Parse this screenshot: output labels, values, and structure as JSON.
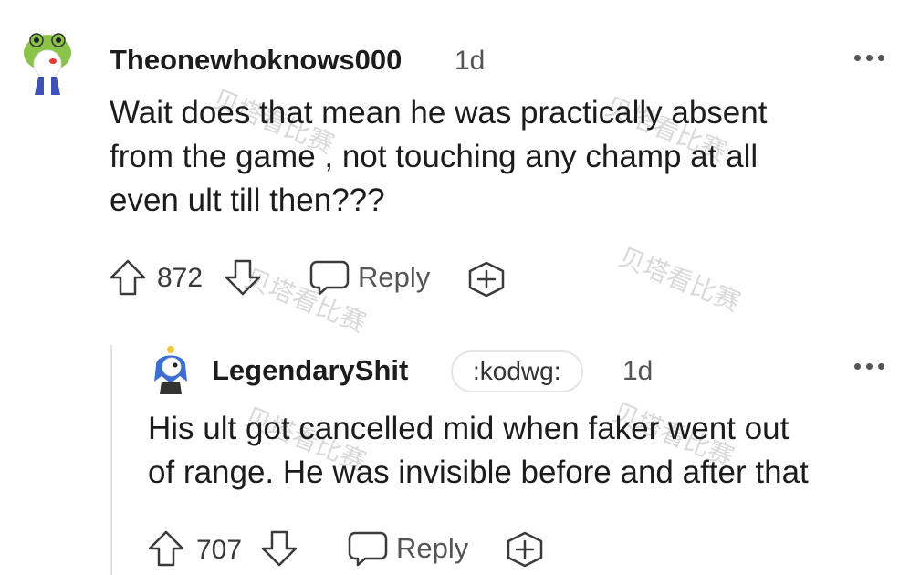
{
  "comment": {
    "username": "Theonewhoknows000",
    "time": "1d",
    "body_lines": [
      "Wait does that mean he was practically absent",
      "from the game , not touching any champ at all",
      "even ult till then???"
    ],
    "upvotes": "872",
    "reply_label": "Reply",
    "avatar_icon": "frog-hat-avatar-icon"
  },
  "reply": {
    "username": "LegendaryShit",
    "flair": ":kodwg:",
    "time": "1d",
    "body_lines": [
      "His ult got cancelled mid when faker went out",
      "of range. He was invisible before and after that"
    ],
    "upvotes": "707",
    "reply_label": "Reply",
    "avatar_icon": "blue-hair-avatar-icon"
  },
  "watermark_text": "贝塔看比赛",
  "colors": {
    "text": "#1c1c1c",
    "muted": "#555555",
    "thread_line": "#e2e2e2"
  }
}
